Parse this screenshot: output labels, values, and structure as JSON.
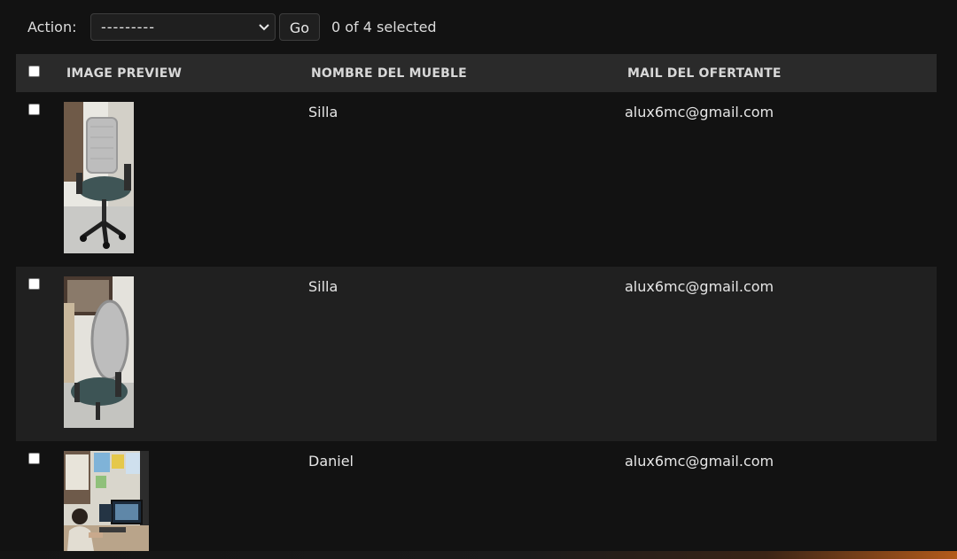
{
  "actions": {
    "label": "Action:",
    "select_value": "---------",
    "go_label": "Go",
    "selection_count": "0 of 4 selected"
  },
  "table": {
    "headers": {
      "image_preview": "IMAGE PREVIEW",
      "nombre": "NOMBRE DEL MUEBLE",
      "mail": "MAIL DEL OFERTANTE"
    },
    "rows": [
      {
        "nombre": "Silla",
        "mail": "alux6mc@gmail.com",
        "image": "office-chair-photo"
      },
      {
        "nombre": "Silla",
        "mail": "alux6mc@gmail.com",
        "image": "office-chair-side-photo"
      },
      {
        "nombre": "Daniel",
        "mail": "alux6mc@gmail.com",
        "image": "person-at-desk-photo"
      }
    ]
  },
  "colors": {
    "background": "#121212",
    "header_bg": "#2a2a2a",
    "row_alt_bg": "#202020",
    "text": "#e6e6e6"
  }
}
